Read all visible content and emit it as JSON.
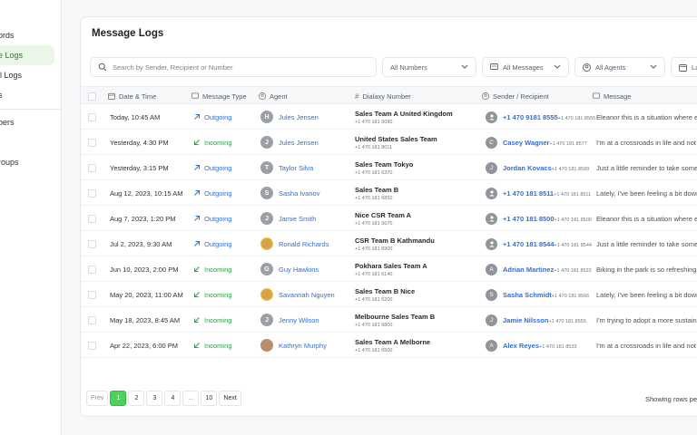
{
  "sidebar": {
    "items": [
      {
        "label": "ords",
        "active": false
      },
      {
        "label": "e Logs",
        "active": true
      },
      {
        "label": "il Logs",
        "active": false
      },
      {
        "label": "s",
        "active": false
      },
      {
        "label": "bers",
        "active": false
      },
      {
        "label": "roups",
        "active": false
      }
    ]
  },
  "page": {
    "title": "Message Logs"
  },
  "filters": {
    "search_placeholder": "Search by Sender, Recipient or Number",
    "numbers": "All Numbers",
    "messages": "All Messages",
    "agents": "All Agents",
    "date": "La"
  },
  "table": {
    "headers": [
      "Date & Time",
      "Message Type",
      "Agent",
      "Dialaxy Number",
      "Sender / Recipient",
      "Message"
    ],
    "rows": [
      {
        "date": "Today, 10:45 AM",
        "type": "Outgoing",
        "agent": "Jules Jensen",
        "agent_initial": "H",
        "number_name": "Sales Team A United Kingdom",
        "number": "+1 470 181 6090",
        "sender_name": "+1 470 9181 8555",
        "sender_sub": "+1 470 181 8555",
        "sender_initial": "",
        "message": "Eleanor this is a situation where exc"
      },
      {
        "date": "Yesterday, 4:30 PM",
        "type": "Incoming",
        "agent": "Jules Jensen",
        "agent_initial": "J",
        "number_name": "United States Sales Team",
        "number": "+1 470 181 8011",
        "sender_name": "Casey Wagner",
        "sender_sub": "+1 470 181 8577",
        "sender_initial": "C",
        "message": "I'm at a crossroads in life and not su"
      },
      {
        "date": "Yesterday, 3:15 PM",
        "type": "Outgoing",
        "agent": "Taylor Silva",
        "agent_initial": "T",
        "number_name": "Sales Team  Tokyo",
        "number": "+1 470 181 6370",
        "sender_name": "Jordan Kovacs",
        "sender_sub": "+1 470 181 8599",
        "sender_initial": "J",
        "message": "Just a little reminder to take some ti"
      },
      {
        "date": "Aug 12, 2023, 10:15 AM",
        "type": "Outgoing",
        "agent": "Sasha Ivanov",
        "agent_initial": "S",
        "number_name": "Sales Team B",
        "number": "+1 470 181 6850",
        "sender_name": "+1 470 181 8511",
        "sender_sub": "+1 470 181 8511",
        "sender_initial": "",
        "message": "Lately, I've been feeling a bit down, a"
      },
      {
        "date": "Aug 7, 2023, 1:20 PM",
        "type": "Outgoing",
        "agent": "Jamie Smith",
        "agent_initial": "J",
        "number_name": "Nice  CSR Team A",
        "number": "+1 470 181 6670",
        "sender_name": "+1 470 181 8500",
        "sender_sub": "+1 470 181 8500",
        "sender_initial": "",
        "message": "Eleanor this is a situation where exc"
      },
      {
        "date": "Jul 2, 2023, 9:30 AM",
        "type": "Outgoing",
        "agent": "Ronald Richards",
        "agent_initial": "",
        "number_name": "CSR Team B Kathmandu",
        "number": "+1 470 181 6900",
        "sender_name": "+1 470 181 8544",
        "sender_sub": "+1 470 181 8544",
        "sender_initial": "",
        "message": "Just a little reminder to take some ti"
      },
      {
        "date": "Jun 10, 2023, 2:00 PM",
        "type": "Incoming",
        "agent": "Guy Hawkins",
        "agent_initial": "G",
        "number_name": "Pokhara Sales Team A",
        "number": "+1 470 181 6140",
        "sender_name": "Adrian Martinez",
        "sender_sub": "+1 470 181 8522",
        "sender_initial": "A",
        "message": "Biking in the park is so refreshing. I w"
      },
      {
        "date": "May 20, 2023, 11:00 AM",
        "type": "Incoming",
        "agent": "Savannah Nguyen",
        "agent_initial": "",
        "number_name": " Sales Team B Nice",
        "number": "+1 470 181 6200",
        "sender_name": "Sasha Schmidt",
        "sender_sub": "+1 470 181 8566",
        "sender_initial": "S",
        "message": "Lately, I've been feeling a bit down, a"
      },
      {
        "date": "May 18, 2023, 8:45 AM",
        "type": "Incoming",
        "agent": "Jenny Wilson",
        "agent_initial": "J",
        "number_name": "Melbourne  Sales Team B",
        "number": "+1 470 181 6800",
        "sender_name": "Jamie Nilsson",
        "sender_sub": "+1 470 181 8555",
        "sender_initial": "J",
        "message": "I'm trying to adopt a more sustainab"
      },
      {
        "date": "Apr 22, 2023, 6:00 PM",
        "type": "Incoming",
        "agent": "Kathryn Murphy",
        "agent_initial": "",
        "number_name": "Sales Team A Melborne",
        "number": "+1 470 181 6500",
        "sender_name": "Alex Reyes",
        "sender_sub": "+1 470 181 8533",
        "sender_initial": "A",
        "message": "I'm at a crossroads in life and not su"
      }
    ]
  },
  "pagination": {
    "prev": "Prev",
    "pages": [
      "1",
      "2",
      "3",
      "4",
      "...",
      "10"
    ],
    "next": "Next",
    "showing": "Showing rows per p"
  },
  "colors": {
    "accent": "#4cd25a",
    "link": "#2f6fd6",
    "incoming": "#2f9c4b"
  }
}
